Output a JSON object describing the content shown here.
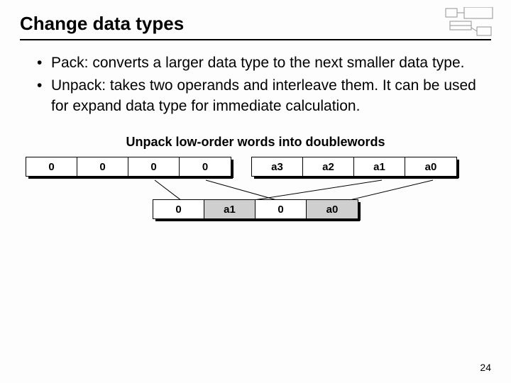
{
  "title": "Change data types",
  "bullets": [
    "Pack: converts a larger data type to the next smaller data type.",
    "Unpack: takes two operands and interleave them. It can be used for expand data type for immediate calculation."
  ],
  "diagram": {
    "caption": "Unpack low-order words into doublewords",
    "operand_left": [
      "0",
      "0",
      "0",
      "0"
    ],
    "operand_right": [
      "a3",
      "a2",
      "a1",
      "a0"
    ],
    "result": [
      {
        "v": "0",
        "shaded": false
      },
      {
        "v": "a1",
        "shaded": true
      },
      {
        "v": "0",
        "shaded": false
      },
      {
        "v": "a0",
        "shaded": true
      }
    ]
  },
  "page_number": "24"
}
